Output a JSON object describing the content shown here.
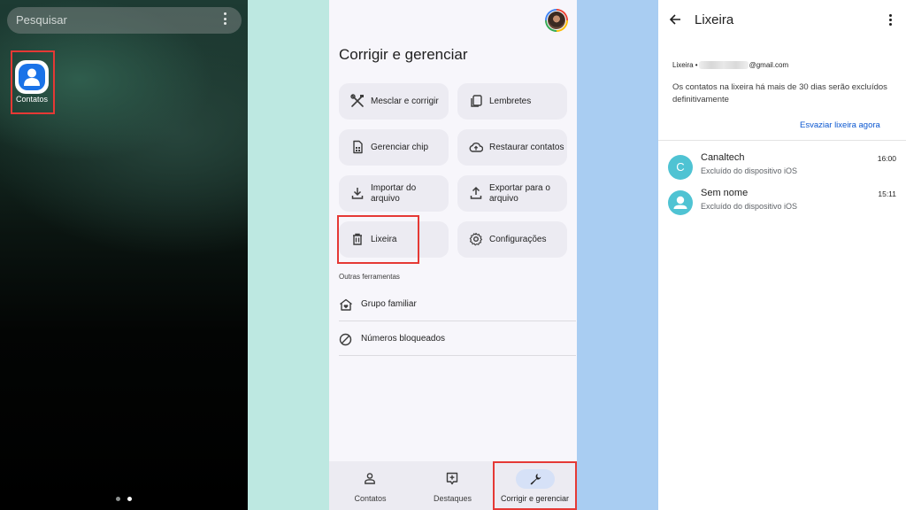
{
  "home": {
    "search_placeholder": "Pesquisar",
    "app_label": "Contatos",
    "page_count": 2,
    "active_page": 2
  },
  "manage": {
    "title": "Corrigir e gerenciar",
    "cards": {
      "merge": "Mesclar e corrigir",
      "reminders": "Lembretes",
      "sim": "Gerenciar chip",
      "restore": "Restaurar contatos",
      "import": "Importar do arquivo",
      "export": "Exportar para o arquivo",
      "trash": "Lixeira",
      "settings": "Configurações"
    },
    "other_tools_label": "Outras ferramentas",
    "other_tools": {
      "family": "Grupo familiar",
      "blocked": "Números bloqueados"
    },
    "nav": {
      "contacts": "Contatos",
      "highlights": "Destaques",
      "manage": "Corrigir e gerenciar",
      "active": "manage"
    }
  },
  "trash": {
    "title": "Lixeira",
    "account_prefix": "Lixeira •",
    "account_suffix": "@gmail.com",
    "notice": "Os contatos na lixeira há mais de 30 dias serão excluídos definitivamente",
    "empty_action": "Esvaziar lixeira agora",
    "contacts": [
      {
        "name": "Canaltech",
        "initial": "C",
        "source": "Excluído do dispositivo iOS",
        "time": "16:00"
      },
      {
        "name": "Sem nome",
        "initial": "",
        "source": "Excluído do dispositivo iOS",
        "time": "15:11"
      }
    ]
  },
  "colors": {
    "highlight": "#e53935",
    "accent": "#0b57d0",
    "avatar": "#4fc3d3",
    "nav_active_pill": "#d6e1f7"
  },
  "icons": {
    "merge": "tools-icon",
    "reminders": "copy-icon",
    "sim": "sim-card-icon",
    "restore": "cloud-upload-icon",
    "import": "download-icon",
    "export": "upload-icon",
    "trash": "trash-icon",
    "settings": "gear-icon",
    "family": "home-heart-icon",
    "blocked": "block-icon",
    "back": "arrow-back-icon",
    "menu": "more-vert-icon"
  }
}
